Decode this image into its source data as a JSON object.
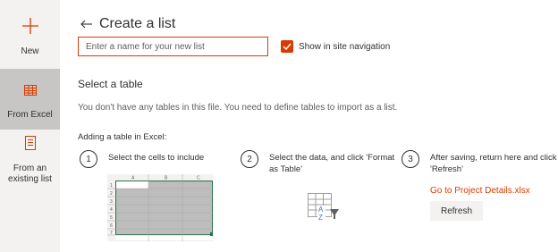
{
  "rail": {
    "new_label": "New",
    "from_excel_label": "From Excel",
    "from_list_label": "From an existing list"
  },
  "header": {
    "title": "Create a list"
  },
  "name_input": {
    "placeholder": "Enter a name for your new list",
    "value": ""
  },
  "nav_option": {
    "label": "Show in site navigation",
    "checked": true
  },
  "table_section": {
    "title": "Select a table",
    "description": "You don't have any tables in this file. You need to define tables to import as a list.",
    "subtitle": "Adding a table in Excel:"
  },
  "steps": [
    {
      "number": "1",
      "text": "Select the cells to include"
    },
    {
      "number": "2",
      "text": "Select the data, and click 'Format as Table'"
    },
    {
      "number": "3",
      "text": "After saving, return here and click 'Refresh'"
    }
  ],
  "spreadsheet": {
    "columns": [
      "A",
      "B",
      "C"
    ],
    "rows": [
      "1",
      "2",
      "3",
      "4",
      "5",
      "6",
      "7"
    ]
  },
  "sort_icon_letters": {
    "top": "A",
    "bottom": "Z"
  },
  "actions": {
    "link": "Go to Project Details.xlsx",
    "refresh": "Refresh"
  },
  "colors": {
    "accent": "#d83b01",
    "rail_bg": "#f3f2f1",
    "rail_selected": "#c8c6c4",
    "excel_green": "#217346"
  },
  "icons": {
    "new": "plus-icon",
    "excel": "table-grid-icon",
    "existing_list": "document-list-icon",
    "back": "back-arrow-icon",
    "check": "checkmark-icon",
    "format_table": "table-sort-icon"
  }
}
